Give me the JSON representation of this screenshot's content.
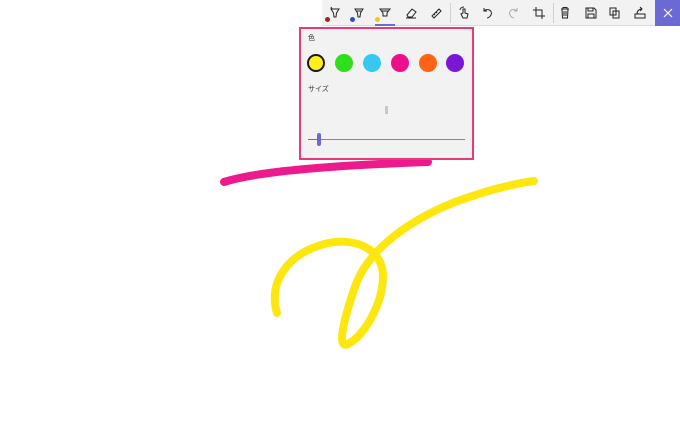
{
  "toolbar": {
    "pen_colors": [
      "#b0201f",
      "#2a4fbf",
      "#f0d000"
    ],
    "icons": [
      "ballpoint-pen-icon",
      "pencil-icon",
      "highlighter-icon",
      "eraser-icon",
      "ruler-icon",
      "touch-writing-icon",
      "undo-icon",
      "redo-icon",
      "crop-icon",
      "delete-icon",
      "save-icon",
      "copy-icon",
      "share-icon",
      "close-icon"
    ]
  },
  "popup": {
    "color_label": "色",
    "size_label": "サイズ",
    "colors": [
      "#fff01a",
      "#2de01b",
      "#37c8f2",
      "#ed0f8a",
      "#ff6314",
      "#7a17d4"
    ],
    "selected_color_index": 0,
    "size_fraction": 0.07
  },
  "colors": {
    "accent": "#6b69d6",
    "popup_border": "#e8397a",
    "stroke_magenta": "#ec1a8c",
    "stroke_yellow": "#fde70f"
  }
}
